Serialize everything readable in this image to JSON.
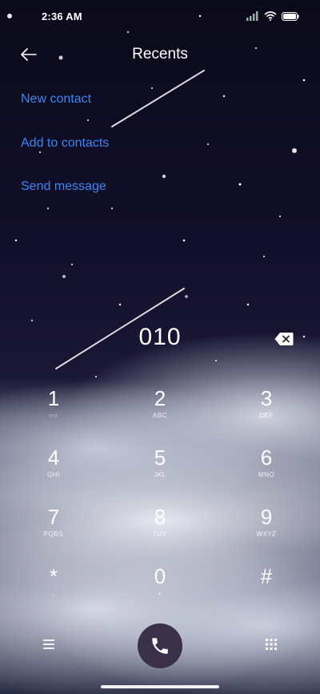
{
  "status": {
    "time": "2:36 AM"
  },
  "header": {
    "title": "Recents",
    "back_icon": "arrow-left-icon"
  },
  "menu": {
    "new_contact": "New contact",
    "add_to_contacts": "Add to contacts",
    "send_message": "Send message"
  },
  "dialer": {
    "number": "010",
    "backspace_icon": "backspace-icon",
    "keys": [
      {
        "digit": "1",
        "letters": "○○"
      },
      {
        "digit": "2",
        "letters": "ABC"
      },
      {
        "digit": "3",
        "letters": "DEF"
      },
      {
        "digit": "4",
        "letters": "GHI"
      },
      {
        "digit": "5",
        "letters": "JKL"
      },
      {
        "digit": "6",
        "letters": "MNO"
      },
      {
        "digit": "7",
        "letters": "PQRS"
      },
      {
        "digit": "8",
        "letters": "TUV"
      },
      {
        "digit": "9",
        "letters": "WXYZ"
      },
      {
        "digit": "*",
        "letters": ","
      },
      {
        "digit": "0",
        "letters": "+"
      },
      {
        "digit": "#",
        "letters": ""
      }
    ]
  },
  "bottom": {
    "menu_icon": "hamburger-icon",
    "call_icon": "phone-icon",
    "keypad_icon": "keypad-grid-icon"
  },
  "colors": {
    "link": "#3b86f2",
    "call_button": "#3a3048"
  }
}
